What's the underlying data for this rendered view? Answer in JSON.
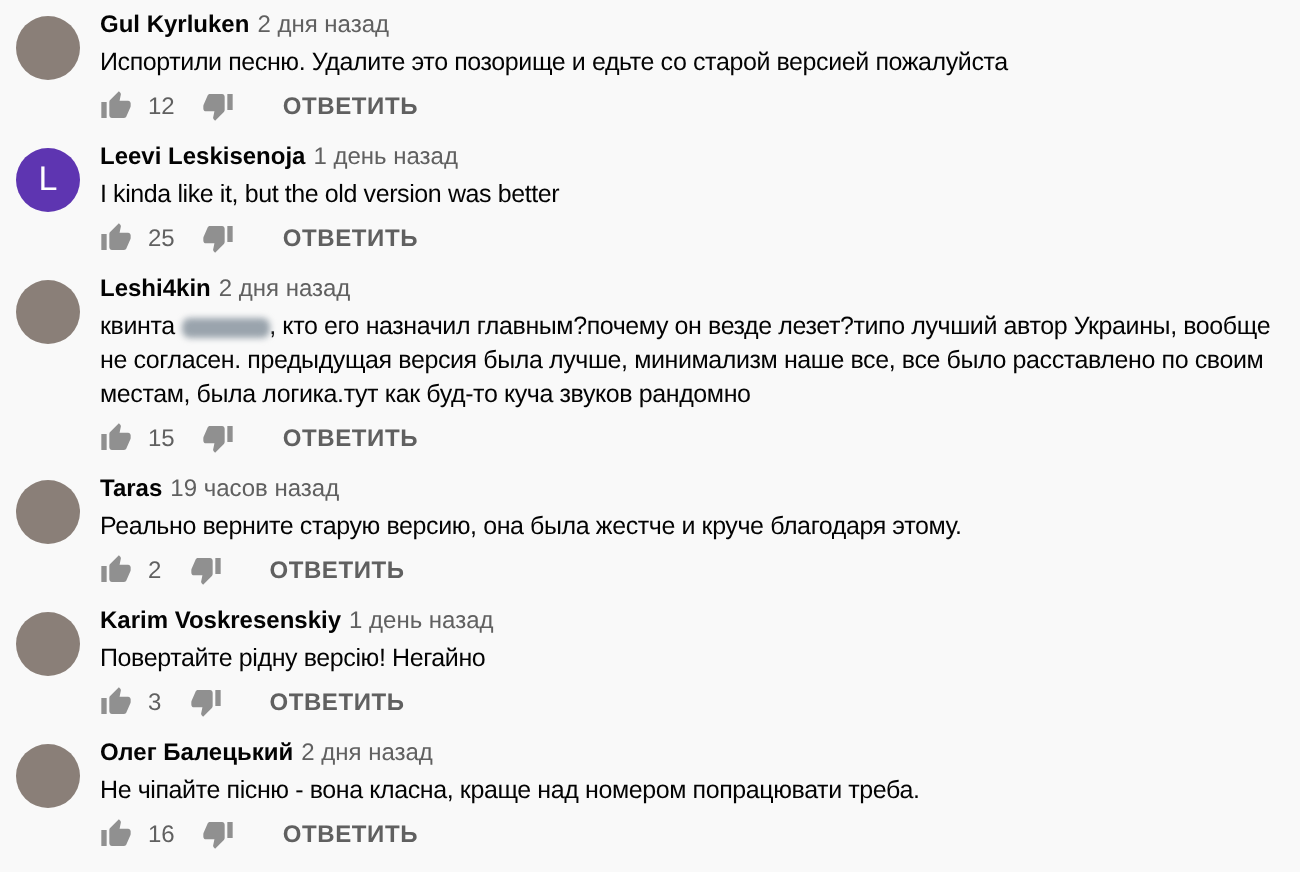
{
  "comments": [
    {
      "author": "Gul Kyrluken",
      "time": "2 дня назад",
      "avatar": {
        "kind": "photo"
      },
      "body": [
        {
          "kind": "text",
          "text": "Испортили песню. Удалите это позорище и едьте со старой версией пожалуйста"
        }
      ],
      "likes": "12",
      "reply_label": "ОТВЕТИТЬ"
    },
    {
      "author": "Leevi Leskisenoja",
      "time": "1 день назад",
      "avatar": {
        "kind": "letter",
        "letter": "L",
        "color": "#5e35b1"
      },
      "body": [
        {
          "kind": "text",
          "text": "I kinda like it, but the old version was better"
        }
      ],
      "likes": "25",
      "reply_label": "ОТВЕТИТЬ"
    },
    {
      "author": "Leshi4kin",
      "time": "2 дня назад",
      "avatar": {
        "kind": "photo"
      },
      "body": [
        {
          "kind": "text",
          "text": "квинта "
        },
        {
          "kind": "redacted"
        },
        {
          "kind": "text",
          "text": ", кто его назначил главным?почему он везде лезет?типо лучший автор Украины, вообще не согласен. предыдущая версия была лучше, минимализм наше все, все было расставлено по своим местам, была логика.тут как буд-то куча звуков рандомно"
        }
      ],
      "likes": "15",
      "reply_label": "ОТВЕТИТЬ"
    },
    {
      "author": "Taras",
      "time": "19 часов назад",
      "avatar": {
        "kind": "photo"
      },
      "body": [
        {
          "kind": "text",
          "text": "Реально верните старую версию, она была жестче и круче благодаря этому."
        }
      ],
      "likes": "2",
      "reply_label": "ОТВЕТИТЬ"
    },
    {
      "author": "Karim Voskresenskiy",
      "time": "1 день назад",
      "avatar": {
        "kind": "photo"
      },
      "body": [
        {
          "kind": "text",
          "text": "Повертайте рідну версію! Негайно"
        }
      ],
      "likes": "3",
      "reply_label": "ОТВЕТИТЬ"
    },
    {
      "author": "Олег Балецький",
      "time": "2 дня назад",
      "avatar": {
        "kind": "photo"
      },
      "body": [
        {
          "kind": "text",
          "text": "Не чіпайте пісню - вона класна, краще над номером попрацювати треба."
        }
      ],
      "likes": "16",
      "reply_label": "ОТВЕТИТЬ"
    }
  ]
}
